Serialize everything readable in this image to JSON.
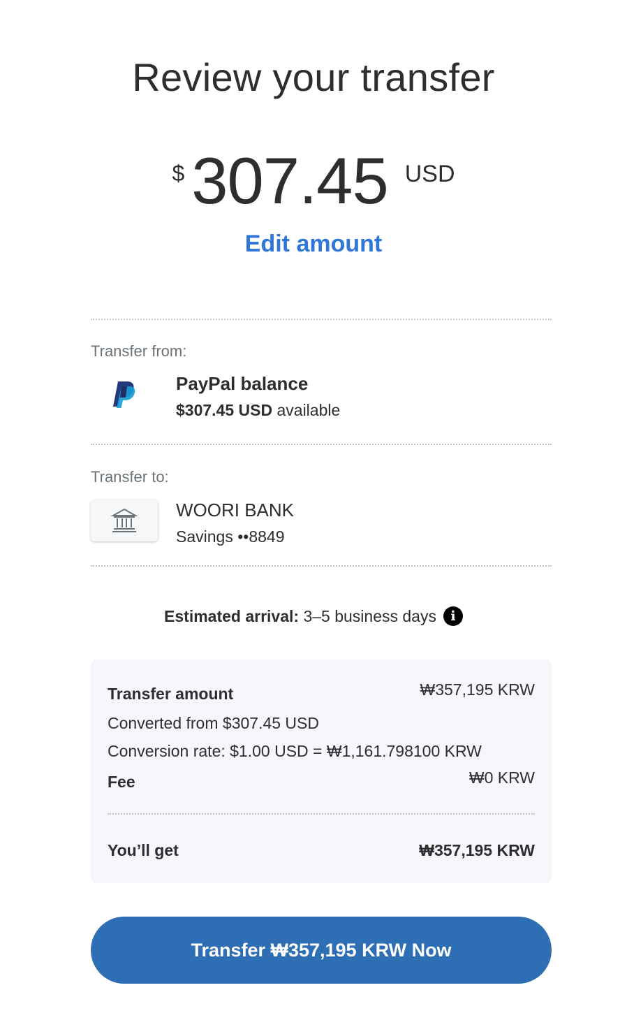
{
  "header": {
    "title": "Review your transfer"
  },
  "amount": {
    "currency_symbol": "$",
    "value": "307.45",
    "currency_code": "USD",
    "edit_label": "Edit amount"
  },
  "transfer_from": {
    "label": "Transfer from:",
    "name": "PayPal balance",
    "balance_amount": "$307.45 USD",
    "balance_suffix": "available",
    "icon": "paypal-logo"
  },
  "transfer_to": {
    "label": "Transfer to:",
    "name": "WOORI BANK",
    "account": "Savings ••8849",
    "icon": "bank-icon"
  },
  "arrival": {
    "label": "Estimated arrival:",
    "value": "3–5 business days",
    "info_icon": "i"
  },
  "summary": {
    "transfer_amount_label": "Transfer amount",
    "transfer_amount_value": "₩357,195 KRW",
    "converted_from": "Converted from $307.45 USD",
    "conversion_rate": "Conversion rate: $1.00 USD = ₩1,161.798100 KRW",
    "fee_label": "Fee",
    "fee_value": "₩0 KRW",
    "you_get_label": "You’ll get",
    "you_get_value": "₩357,195 KRW"
  },
  "cta": {
    "label": "Transfer ₩357,195 KRW Now"
  },
  "colors": {
    "link": "#2f76d9",
    "button": "#2d6eb5",
    "paypal_dark": "#253b80",
    "paypal_light": "#179bd7",
    "summary_bg": "#f5f7fa"
  }
}
